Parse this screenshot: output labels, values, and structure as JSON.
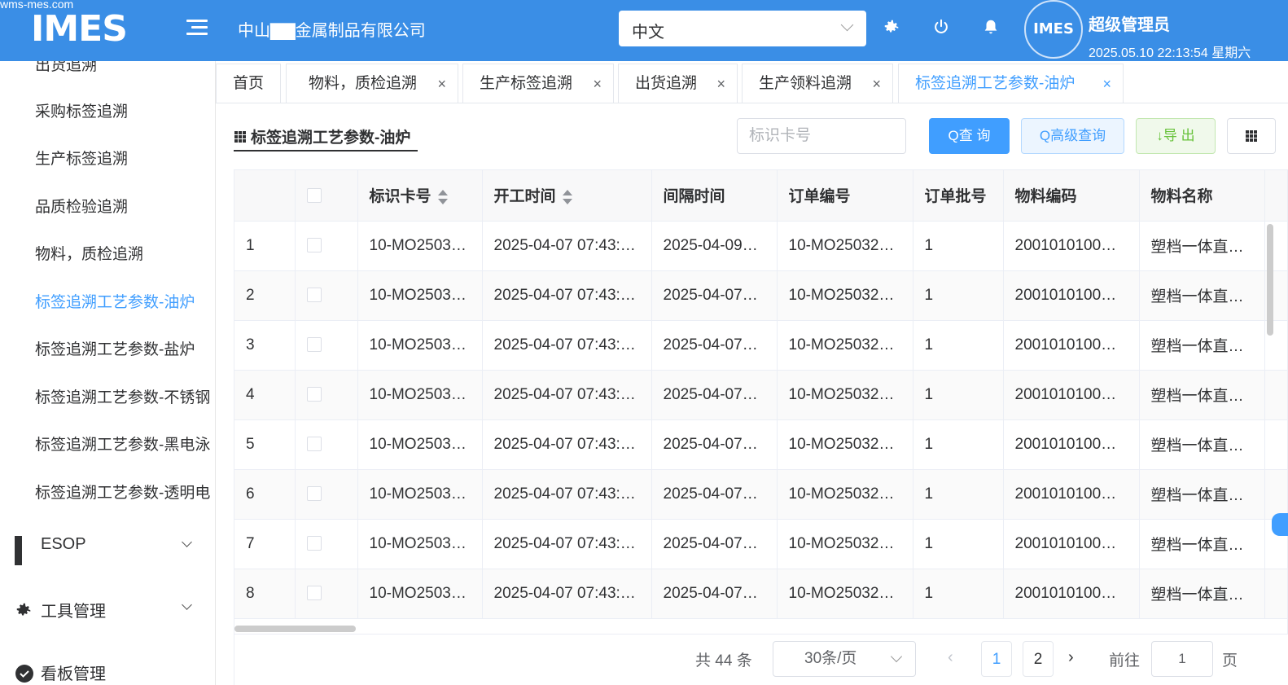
{
  "watermark": "wms-mes.com",
  "header": {
    "logo": "IMES",
    "company": "中山▇▇金属制品有限公司",
    "language": "中文",
    "avatar_text": "IMES",
    "user_name": "超级管理员",
    "datetime": "2025.05.10 22:13:54 星期六"
  },
  "sidebar": {
    "items": [
      {
        "label": "出货追溯"
      },
      {
        "label": "采购标签追溯"
      },
      {
        "label": "生产标签追溯"
      },
      {
        "label": "品质检验追溯"
      },
      {
        "label": "物料，质检追溯"
      },
      {
        "label": "标签追溯工艺参数-油炉"
      },
      {
        "label": "标签追溯工艺参数-盐炉"
      },
      {
        "label": "标签追溯工艺参数-不锈钢"
      },
      {
        "label": "标签追溯工艺参数-黑电泳"
      },
      {
        "label": "标签追溯工艺参数-透明电"
      }
    ],
    "groups": [
      {
        "label": "ESOP"
      },
      {
        "label": "工具管理"
      },
      {
        "label": "看板管理"
      }
    ]
  },
  "tabs": [
    {
      "label": "首页"
    },
    {
      "label": "物料，质检追溯"
    },
    {
      "label": "生产标签追溯"
    },
    {
      "label": "出货追溯"
    },
    {
      "label": "生产领料追溯"
    },
    {
      "label": "标签追溯工艺参数-油炉"
    }
  ],
  "toolbar": {
    "title": "标签追溯工艺参数-油炉",
    "search_placeholder": "标识卡号",
    "query_label": "Q查 询",
    "advanced_label": "Q高级查询",
    "export_label": "↓导 出"
  },
  "table": {
    "columns": [
      "标识卡号",
      "开工时间",
      "间隔时间",
      "订单编号",
      "订单批号",
      "物料编码",
      "物料名称"
    ],
    "rows": [
      {
        "idx": "1",
        "card": "10-MO2503…",
        "start": "2025-04-07 07:43:…",
        "interval": "2025-04-09…",
        "order": "10-MO25032…",
        "batch": "1",
        "code": "2001010100…",
        "name": "塑档一体直…"
      },
      {
        "idx": "2",
        "card": "10-MO2503…",
        "start": "2025-04-07 07:43:…",
        "interval": "2025-04-07…",
        "order": "10-MO25032…",
        "batch": "1",
        "code": "2001010100…",
        "name": "塑档一体直…"
      },
      {
        "idx": "3",
        "card": "10-MO2503…",
        "start": "2025-04-07 07:43:…",
        "interval": "2025-04-07…",
        "order": "10-MO25032…",
        "batch": "1",
        "code": "2001010100…",
        "name": "塑档一体直…"
      },
      {
        "idx": "4",
        "card": "10-MO2503…",
        "start": "2025-04-07 07:43:…",
        "interval": "2025-04-07…",
        "order": "10-MO25032…",
        "batch": "1",
        "code": "2001010100…",
        "name": "塑档一体直…"
      },
      {
        "idx": "5",
        "card": "10-MO2503…",
        "start": "2025-04-07 07:43:…",
        "interval": "2025-04-07…",
        "order": "10-MO25032…",
        "batch": "1",
        "code": "2001010100…",
        "name": "塑档一体直…"
      },
      {
        "idx": "6",
        "card": "10-MO2503…",
        "start": "2025-04-07 07:43:…",
        "interval": "2025-04-07…",
        "order": "10-MO25032…",
        "batch": "1",
        "code": "2001010100…",
        "name": "塑档一体直…"
      },
      {
        "idx": "7",
        "card": "10-MO2503…",
        "start": "2025-04-07 07:43:…",
        "interval": "2025-04-07…",
        "order": "10-MO25032…",
        "batch": "1",
        "code": "2001010100…",
        "name": "塑档一体直…"
      },
      {
        "idx": "8",
        "card": "10-MO2503…",
        "start": "2025-04-07 07:43:…",
        "interval": "2025-04-07…",
        "order": "10-MO25032…",
        "batch": "1",
        "code": "2001010100…",
        "name": "塑档一体直…"
      }
    ]
  },
  "pagination": {
    "total": "共 44 条",
    "page_size": "30条/页",
    "pages": [
      "1",
      "2"
    ],
    "goto_label": "前往",
    "goto_value": "1",
    "page_suffix": "页"
  },
  "colors": {
    "header_bg": "#3a8ee6",
    "accent": "#409eff",
    "export_green": "#67c23a"
  }
}
